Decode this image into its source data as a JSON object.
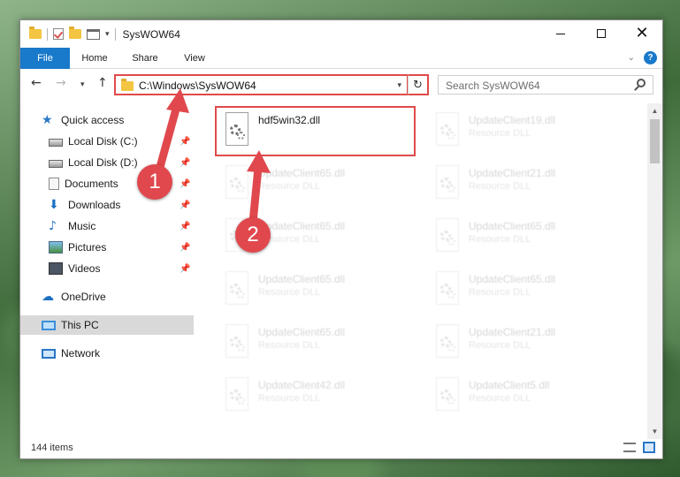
{
  "window": {
    "title": "SysWOW64"
  },
  "ribbon": {
    "tabs": {
      "file": "File",
      "home": "Home",
      "share": "Share",
      "view": "View"
    }
  },
  "address": {
    "path": "C:\\Windows\\SysWOW64"
  },
  "search": {
    "placeholder": "Search SysWOW64"
  },
  "sidebar": {
    "quick_access": "Quick access",
    "items": [
      {
        "label": "Local Disk (C:)",
        "icon": "drive-icon",
        "pinned": true
      },
      {
        "label": "Local Disk (D:)",
        "icon": "drive-icon",
        "pinned": true
      },
      {
        "label": "Documents",
        "icon": "documents-icon",
        "pinned": true
      },
      {
        "label": "Downloads",
        "icon": "downloads-icon",
        "pinned": true
      },
      {
        "label": "Music",
        "icon": "music-icon",
        "pinned": true
      },
      {
        "label": "Pictures",
        "icon": "pictures-icon",
        "pinned": true
      },
      {
        "label": "Videos",
        "icon": "videos-icon",
        "pinned": true
      }
    ],
    "onedrive": "OneDrive",
    "this_pc": "This PC",
    "network": "Network"
  },
  "files": [
    {
      "name": "hdf5win32.dll",
      "type": ""
    },
    {
      "name": "UpdateClient19.dll",
      "type": "Resource DLL"
    },
    {
      "name": "UpdateClient65.dll",
      "type": "Resource DLL"
    },
    {
      "name": "UpdateClient21.dll",
      "type": "Resource DLL"
    },
    {
      "name": "UpdateClient65.dll",
      "type": "Resource DLL"
    },
    {
      "name": "UpdateClient65.dll",
      "type": "Resource DLL"
    },
    {
      "name": "UpdateClient65.dll",
      "type": "Resource DLL"
    },
    {
      "name": "UpdateClient65.dll",
      "type": "Resource DLL"
    },
    {
      "name": "UpdateClient65.dll",
      "type": "Resource DLL"
    },
    {
      "name": "UpdateClient21.dll",
      "type": "Resource DLL"
    },
    {
      "name": "UpdateClient42.dll",
      "type": "Resource DLL"
    },
    {
      "name": "UpdateClient5.dll",
      "type": "Resource DLL"
    }
  ],
  "status": {
    "items": "144 items"
  },
  "annotations": {
    "step1": "1",
    "step2": "2",
    "color": "#e0484d"
  },
  "colors": {
    "accent": "#1979ca",
    "highlight": "#e04a4a"
  }
}
